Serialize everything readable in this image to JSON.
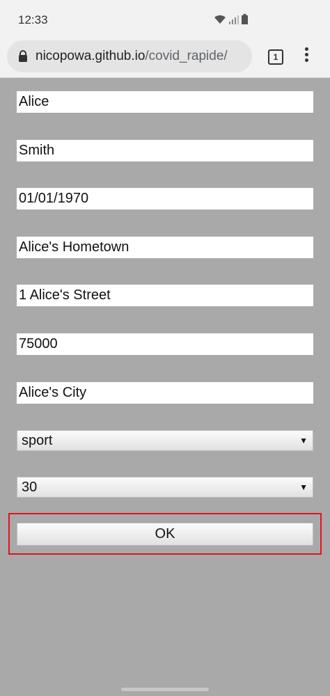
{
  "status": {
    "time": "12:33"
  },
  "browser": {
    "url_domain": "nicopowa.github.io",
    "url_path": "/covid_rapide/",
    "tab_count": "1"
  },
  "form": {
    "first_name": "Alice",
    "last_name": "Smith",
    "birth_date": "01/01/1970",
    "birth_place": "Alice's Hometown",
    "address": "1 Alice's Street",
    "zip_code": "75000",
    "city": "Alice's City",
    "reason_select": "sport",
    "minutes_select": "30",
    "ok_label": "OK"
  }
}
